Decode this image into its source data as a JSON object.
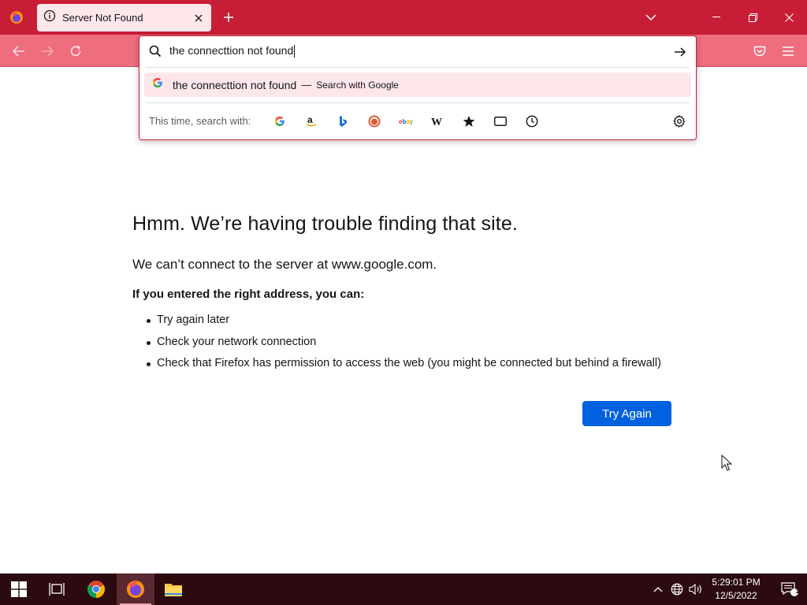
{
  "browser": {
    "tab": {
      "title": "Server Not Found"
    }
  },
  "urlbar": {
    "value": "the connecttion not found",
    "suggestion": {
      "text": "the connecttion not found",
      "separator": "—",
      "action": "Search with Google"
    },
    "oneoff_label": "This time, search with:",
    "engines": [
      "google-icon",
      "amazon-icon",
      "bing-icon",
      "duckduckgo-icon",
      "ebay-icon",
      "wikipedia-icon",
      "bookmarks-icon",
      "tabs-icon",
      "history-icon"
    ]
  },
  "error": {
    "title": "Hmm. We’re having trouble finding that site.",
    "description": "We can’t connect to the server at www.google.com.",
    "subtitle": "If you entered the right address, you can:",
    "items": [
      "Try again later",
      "Check your network connection",
      "Check that Firefox has permission to access the web (you might be connected but behind a firewall)"
    ],
    "button_label": "Try Again"
  },
  "taskbar": {
    "time": "5:29:01 PM",
    "date": "12/5/2022",
    "notification_count": "1"
  },
  "colors": {
    "tabstrip": "#c81d36",
    "navbar": "#ef6e7e",
    "accent_button": "#0061e0",
    "taskbar": "#2b0a10"
  }
}
